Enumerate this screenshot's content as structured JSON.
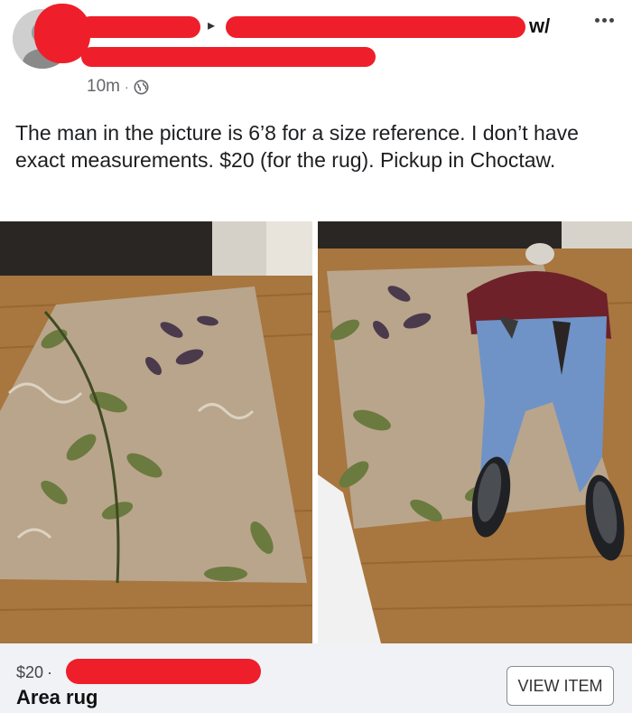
{
  "post": {
    "author_line": {
      "arrow": "▸",
      "group_suffix": "w/"
    },
    "timestamp": "10m",
    "meta_separator": "·",
    "privacy_icon": "globe-icon",
    "more_icon": "more-options-icon",
    "text": "The man in the picture is 6’8 for a size reference. I don’t have exact measurements. $20 (for the rug). Pickup in Choctaw."
  },
  "listing": {
    "price": "$20",
    "separator": "·",
    "title": "Area rug",
    "button_label": "VIEW ITEM"
  },
  "colors": {
    "redaction": "#ee1f2a",
    "rug": "#b9a58c",
    "floor": "#a8763f",
    "footer_bg": "#f0f2f5",
    "muted_text": "#65676b"
  }
}
